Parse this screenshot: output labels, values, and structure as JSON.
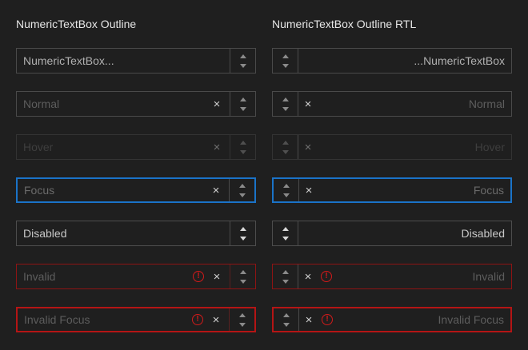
{
  "columns": {
    "ltr": {
      "heading": "NumericTextBox Outline"
    },
    "rtl": {
      "heading": "NumericTextBox Outline RTL"
    }
  },
  "rows": [
    {
      "state": "placeholder",
      "ltr_text": "NumericTextBox...",
      "rtl_text": "...NumericTextBox",
      "clear_button": false,
      "error_icon": false
    },
    {
      "state": "normal",
      "ltr_text": "Normal",
      "rtl_text": "Normal",
      "clear_button": true,
      "error_icon": false
    },
    {
      "state": "hover",
      "ltr_text": "Hover",
      "rtl_text": "Hover",
      "clear_button": true,
      "error_icon": false
    },
    {
      "state": "focus",
      "ltr_text": "Focus",
      "rtl_text": "Focus",
      "clear_button": true,
      "error_icon": false
    },
    {
      "state": "disabled",
      "ltr_text": "Disabled",
      "rtl_text": "Disabled",
      "clear_button": false,
      "error_icon": false
    },
    {
      "state": "invalid",
      "ltr_text": "Invalid",
      "rtl_text": "Invalid",
      "clear_button": true,
      "error_icon": true
    },
    {
      "state": "invalid-focus",
      "ltr_text": "Invalid Focus",
      "rtl_text": "Invalid Focus",
      "clear_button": true,
      "error_icon": true
    }
  ],
  "icons": {
    "clear": "×",
    "error": "!",
    "spin_up": "chevron-up-icon",
    "spin_down": "chevron-down-icon"
  },
  "colors": {
    "background": "#1f1f1f",
    "border": "#4a4a4a",
    "focus_border": "#1a73c8",
    "invalid_border": "#8e1414",
    "invalid_focus_border": "#b51515",
    "error_icon": "#d21a1a"
  }
}
